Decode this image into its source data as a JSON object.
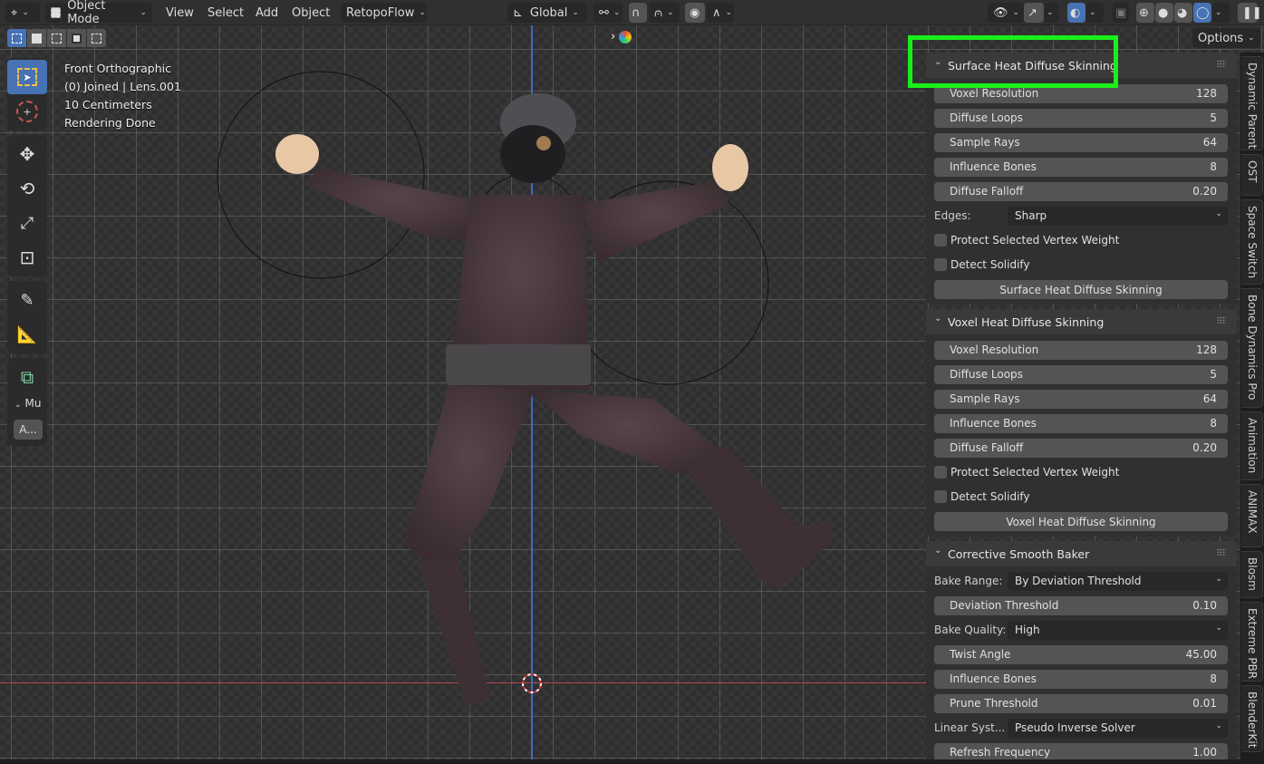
{
  "header": {
    "editor_type": "3d-viewport-icon",
    "mode": "Object Mode",
    "menus": [
      "View",
      "Select",
      "Add",
      "Object"
    ],
    "addon_menu": "RetopoFlow",
    "orientation": "Global",
    "pivot": "pivot-icon",
    "snap": "snap-icon",
    "proportional": "proportional-icon"
  },
  "options_label": "Options",
  "overlay_info": {
    "view": "Front Orthographic",
    "object": "(0) Joined | Lens.001",
    "scale": "10 Centimeters",
    "status": "Rendering Done"
  },
  "mini_panel": {
    "header": "Mu",
    "button": "A..."
  },
  "colors": {
    "accent": "#4772b3",
    "highlight": "#19f019",
    "x_axis": "#b8454f",
    "z_axis": "#3f6ac0"
  },
  "panels": {
    "surface": {
      "title": "Surface Heat Diffuse Skinning",
      "fields": [
        {
          "label": "Voxel Resolution",
          "value": "128"
        },
        {
          "label": "Diffuse Loops",
          "value": "5"
        },
        {
          "label": "Sample Rays",
          "value": "64"
        },
        {
          "label": "Influence Bones",
          "value": "8"
        },
        {
          "label": "Diffuse Falloff",
          "value": "0.20"
        }
      ],
      "edges_label": "Edges:",
      "edges_value": "Sharp",
      "checkboxes": [
        "Protect Selected Vertex Weight",
        "Detect Solidify"
      ],
      "button": "Surface Heat Diffuse Skinning"
    },
    "voxel": {
      "title": "Voxel Heat Diffuse Skinning",
      "fields": [
        {
          "label": "Voxel Resolution",
          "value": "128"
        },
        {
          "label": "Diffuse Loops",
          "value": "5"
        },
        {
          "label": "Sample Rays",
          "value": "64"
        },
        {
          "label": "Influence Bones",
          "value": "8"
        },
        {
          "label": "Diffuse Falloff",
          "value": "0.20"
        }
      ],
      "checkboxes": [
        "Protect Selected Vertex Weight",
        "Detect Solidify"
      ],
      "button": "Voxel Heat Diffuse Skinning"
    },
    "corrective": {
      "title": "Corrective Smooth Baker",
      "bake_range_label": "Bake Range:",
      "bake_range_value": "By Deviation Threshold",
      "deviation": {
        "label": "Deviation Threshold",
        "value": "0.10"
      },
      "bake_quality_label": "Bake Quality:",
      "bake_quality_value": "High",
      "twist": {
        "label": "Twist Angle",
        "value": "45.00"
      },
      "influence": {
        "label": "Influence Bones",
        "value": "8"
      },
      "prune": {
        "label": "Prune Threshold",
        "value": "0.01"
      },
      "linear_label": "Linear Syst...",
      "linear_value": "Pseudo Inverse Solver",
      "refresh": {
        "label": "Refresh Frequency",
        "value": "1.00"
      }
    }
  },
  "tabs": [
    "Dynamic Parent",
    "OST",
    "Space Switch",
    "Bone Dynamics Pro",
    "Animation",
    "ANIMAX",
    "Blosm",
    "Extreme PBR",
    "BlenderKit"
  ]
}
